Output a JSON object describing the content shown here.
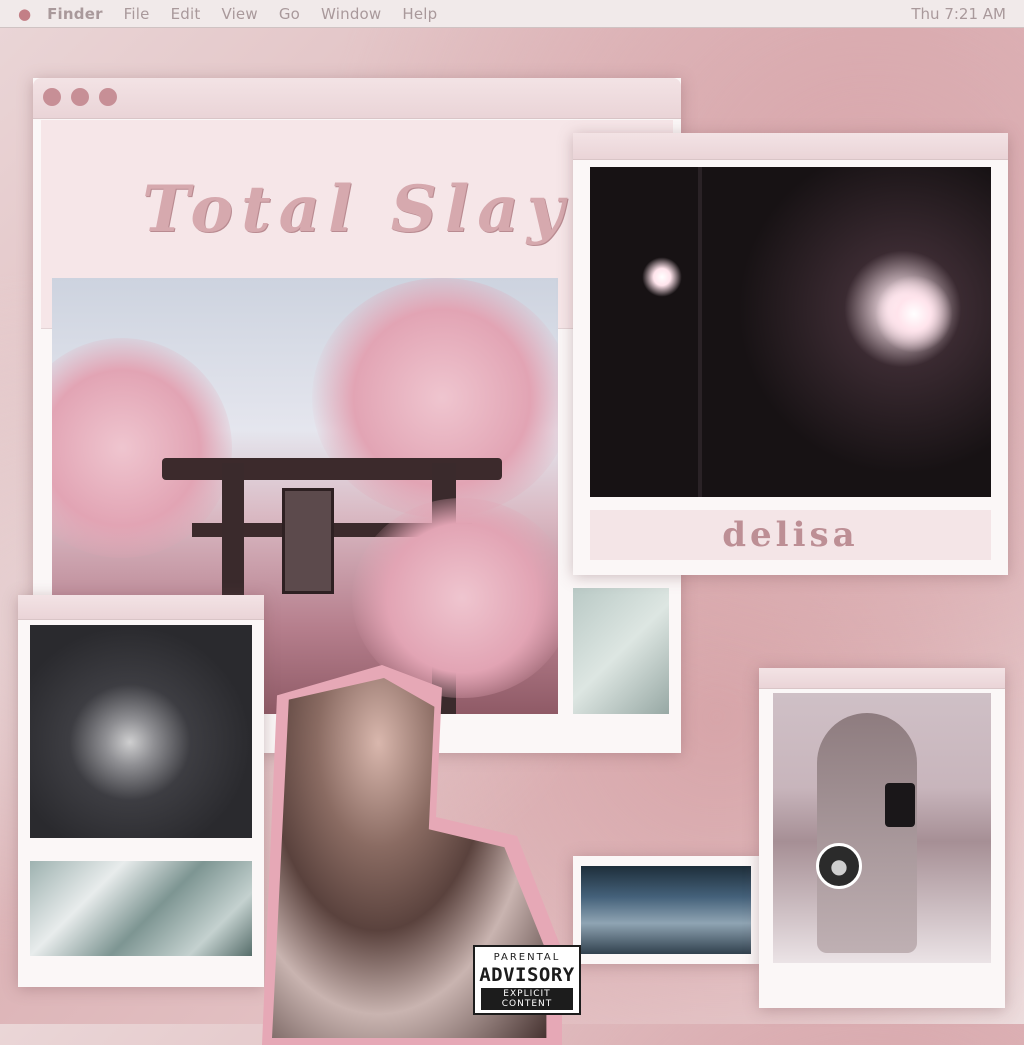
{
  "menubar": {
    "apple_icon": "apple-icon",
    "items": [
      "Finder",
      "File",
      "Edit",
      "View",
      "Go",
      "Window",
      "Help"
    ],
    "clock": "Thu 7:21 AM"
  },
  "main_window": {
    "title": "Total Slay",
    "controls": [
      "close",
      "minimize",
      "zoom"
    ],
    "accent": "#c78f96"
  },
  "photo_window": {
    "caption": "delisa"
  },
  "advisory": {
    "line1": "PARENTAL",
    "line2": "ADVISORY",
    "line3": "EXPLICIT CONTENT"
  },
  "colors": {
    "background": "#dcb3b6",
    "window": "#fbf7f7",
    "title_text": "#d6a9ae"
  }
}
